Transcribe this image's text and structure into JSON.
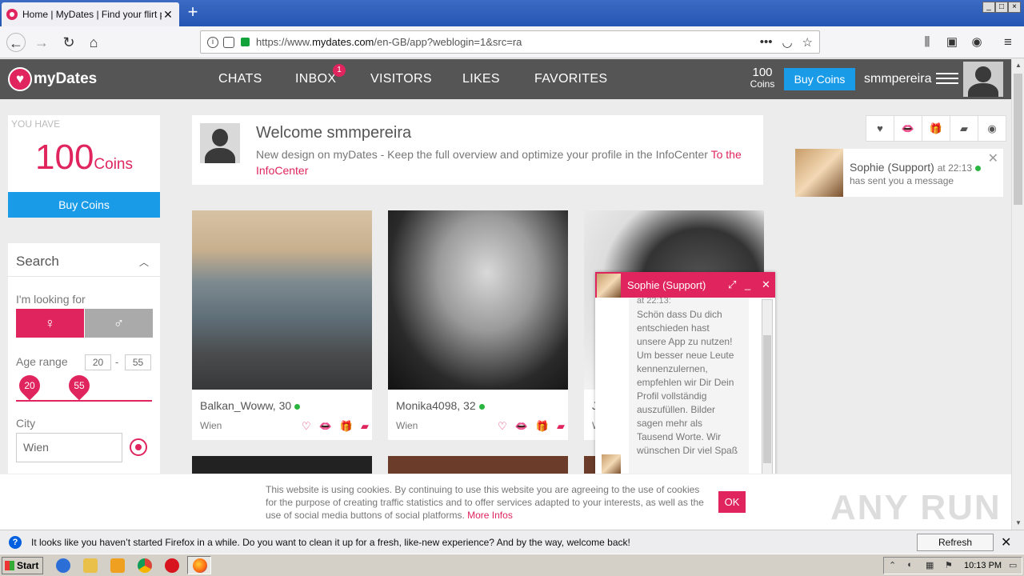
{
  "browser": {
    "tab_title": "Home | MyDates | Find your flirt p",
    "tab_close": "✕",
    "new_tab": "+",
    "url_prefix": "https://www.",
    "url_domain": "mydates.com",
    "url_path": "/en-GB/app?weblogin=1&src=ra",
    "url_more": "•••"
  },
  "header": {
    "logo_text": "myDates",
    "nav": [
      "CHATS",
      "INBOX",
      "VISITORS",
      "LIKES",
      "FAVORITES"
    ],
    "inbox_badge": "1",
    "coins_count": "100",
    "coins_label": "Coins",
    "buy_coins": "Buy Coins",
    "username": "smmpereira"
  },
  "coins_panel": {
    "you_have": "YOU HAVE",
    "amount": "100",
    "unit": "Coins",
    "button": "Buy Coins"
  },
  "search": {
    "title": "Search",
    "looking_for": "I'm looking for",
    "age_label": "Age range",
    "age_min": "20",
    "age_sep": "-",
    "age_max": "55",
    "city_label": "City",
    "city_value": "Wien"
  },
  "welcome": {
    "title": "Welcome smmpereira",
    "text": "New design on myDates - Keep the full overview and optimize your profile in the InfoCenter ",
    "link": "To the InfoCenter"
  },
  "profiles": [
    {
      "name": "Balkan_Woww, 30",
      "city": "Wien"
    },
    {
      "name": "Monika4098, 32",
      "city": "Wien"
    },
    {
      "name": "J",
      "city": "W"
    }
  ],
  "notification": {
    "name": "Sophie (Support)",
    "time": "at 22:13",
    "message": "has sent you a message"
  },
  "chat": {
    "name": "Sophie (Support)",
    "time": "at 22:13:",
    "message": "Schön dass Du dich entschieden hast unsere App zu nutzen! Um besser neue Leute kennenzulernen, empfehlen wir Dir Dein Profil vollständig auszufüllen. Bilder sagen mehr als Tausend Worte. Wir wünschen Dir viel Spaß"
  },
  "cookie": {
    "text": "This website is using cookies. By continuing to use this website you are agreeing to the use of cookies for the purpose of creating traffic statistics and to offer services adapted to your interests, as well as the use of social media buttons of social platforms. ",
    "link": "More Infos",
    "ok": "OK"
  },
  "watermark": "ANY RUN",
  "firefox_bar": {
    "message": "It looks like you haven’t started Firefox in a while. Do you want to clean it up for a fresh, like-new experience? And by the way, welcome back!",
    "button": "Refresh Firefox…"
  },
  "taskbar": {
    "start": "Start",
    "clock": "10:13 PM"
  },
  "colors": {
    "brand": "#e0245e",
    "accent_blue": "#1a9be8",
    "header_bg": "#555555",
    "online": "#2ab540"
  },
  "icons": [
    "heart-icon",
    "kiss-icon",
    "gift-icon",
    "chat-icon",
    "eye-icon",
    "location-icon",
    "female-icon",
    "male-icon"
  ]
}
